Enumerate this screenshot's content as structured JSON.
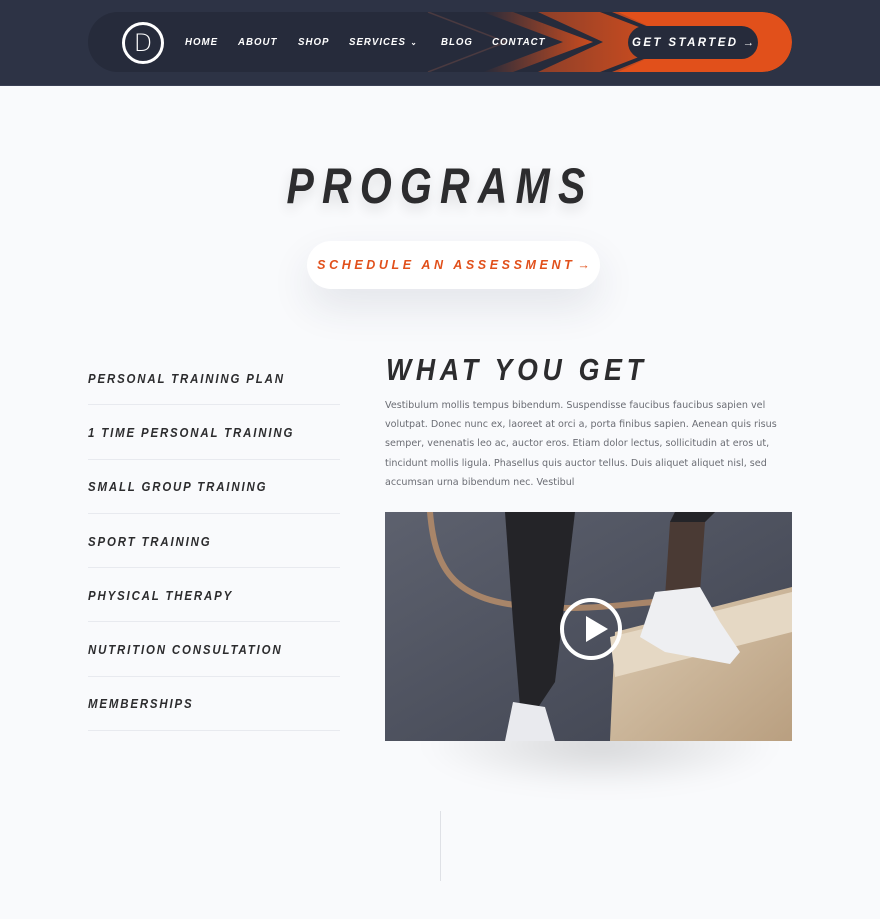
{
  "header": {
    "logo_letter": "D",
    "nav": [
      {
        "label": "Home"
      },
      {
        "label": "About"
      },
      {
        "label": "Shop"
      },
      {
        "label": "Services",
        "has_dropdown": true,
        "dropdown_icon": "chevron-down-icon"
      },
      {
        "label": "Blog"
      },
      {
        "label": "Contact"
      }
    ],
    "cta_label": "GET STARTED",
    "cta_arrow": "→",
    "colors": {
      "bar": "#2d3345",
      "pill": "#262b3b",
      "accent": "#e1501b"
    }
  },
  "hero": {
    "title": "PROGRAMS",
    "button_label": "SCHEDULE AN ASSESSMENT",
    "button_arrow": "→"
  },
  "programs": [
    "Personal Training Plan",
    "1 Time Personal Training",
    "Small Group Training",
    "Sport Training",
    "Physical Therapy",
    "Nutrition Consultation",
    "Memberships"
  ],
  "what_you_get": {
    "title": "WHAT YOU GET",
    "body": "Vestibulum mollis tempus bibendum. Suspendisse faucibus faucibus sapien vel volutpat. Donec nunc ex, laoreet at orci a, porta finibus sapien. Aenean quis risus semper, venenatis leo ac, auctor eros. Etiam dolor lectus, sollicitudin at eros ut, tincidunt mollis ligula. Phasellus quis auctor tellus. Duis aliquet aliquet nisl, sed accumsan urna bibendum nec. Vestibul"
  },
  "video": {
    "play_icon": "play-icon"
  }
}
